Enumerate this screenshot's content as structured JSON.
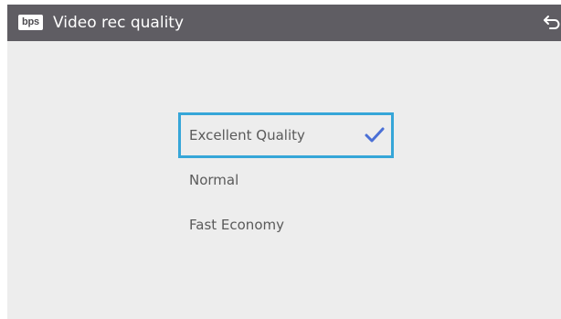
{
  "header": {
    "icon_text": "bps",
    "title": "Video rec quality",
    "back_icon": "back-arrow-icon"
  },
  "options": [
    {
      "label": "Excellent Quality",
      "selected": true
    },
    {
      "label": "Normal",
      "selected": false
    },
    {
      "label": "Fast Economy",
      "selected": false
    }
  ],
  "colors": {
    "header_bg": "#5f5d63",
    "content_bg": "#ededed",
    "selection_border": "#36a6d8",
    "checkmark": "#4a6fd6"
  }
}
